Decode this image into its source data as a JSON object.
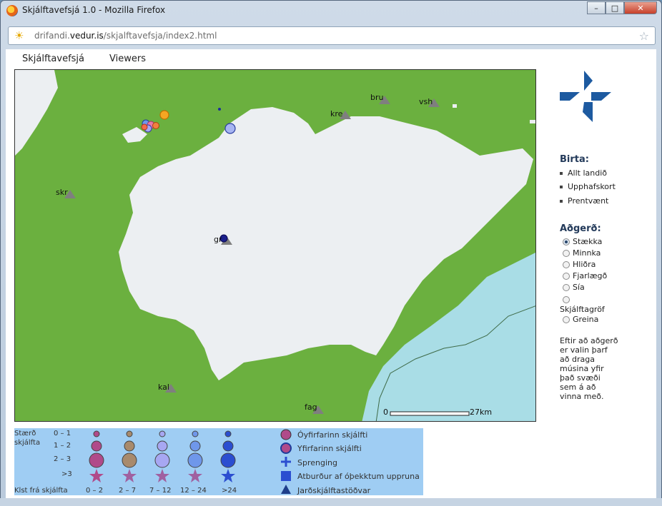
{
  "window": {
    "title": "Skjálftavefsjá 1.0 - Mozilla Firefox",
    "min": "–",
    "max": "□",
    "close": "✕"
  },
  "urlbar": {
    "prefix": "drifandi.",
    "domain": "vedur.is",
    "path": "/skjalftavefsja/index2.html"
  },
  "menu": {
    "item1": "Skjálftavefsjá",
    "item2": "Viewers"
  },
  "map": {
    "stations": [
      "bru",
      "vsh",
      "kre",
      "skr",
      "gr",
      "kal",
      "fag"
    ],
    "scale_start": "0",
    "scale_end": "27km"
  },
  "sidebar": {
    "birta_heading": "Birta:",
    "birta_items": [
      "Allt landið",
      "Upphafskort",
      "Prentvænt"
    ],
    "adgerd_heading": "Aðgerð:",
    "radios": [
      "Stækka",
      "Minnka",
      "Hliðra",
      "Fjarlægð",
      "Sía",
      "Skjálftagröf",
      "Greina"
    ],
    "selected": "Stækka",
    "help": "Eftir að aðgerð er valin þarf að draga músina yfir það svæði sem á að vinna með."
  },
  "legend": {
    "size_label_1": "Stærð",
    "size_label_2": "skjálfta",
    "rows": [
      "0 – 1",
      "1 – 2",
      "2 – 3",
      ">3"
    ],
    "hours_label": "Klst frá skjálfta",
    "hours": [
      "0 – 2",
      "2 – 7",
      "7 – 12",
      "12 – 24",
      ">24"
    ],
    "types": [
      "Óyfirfarinn skjálfti",
      "Yfirfarinn skjálfti",
      "Sprenging",
      "Atburður af óþekktum uppruna",
      "Jarðskjálftastöðvar"
    ],
    "colors": [
      "#b04a8a",
      "#a88a6c",
      "#a7a7f2",
      "#6f97ea",
      "#2b4ed0"
    ]
  }
}
